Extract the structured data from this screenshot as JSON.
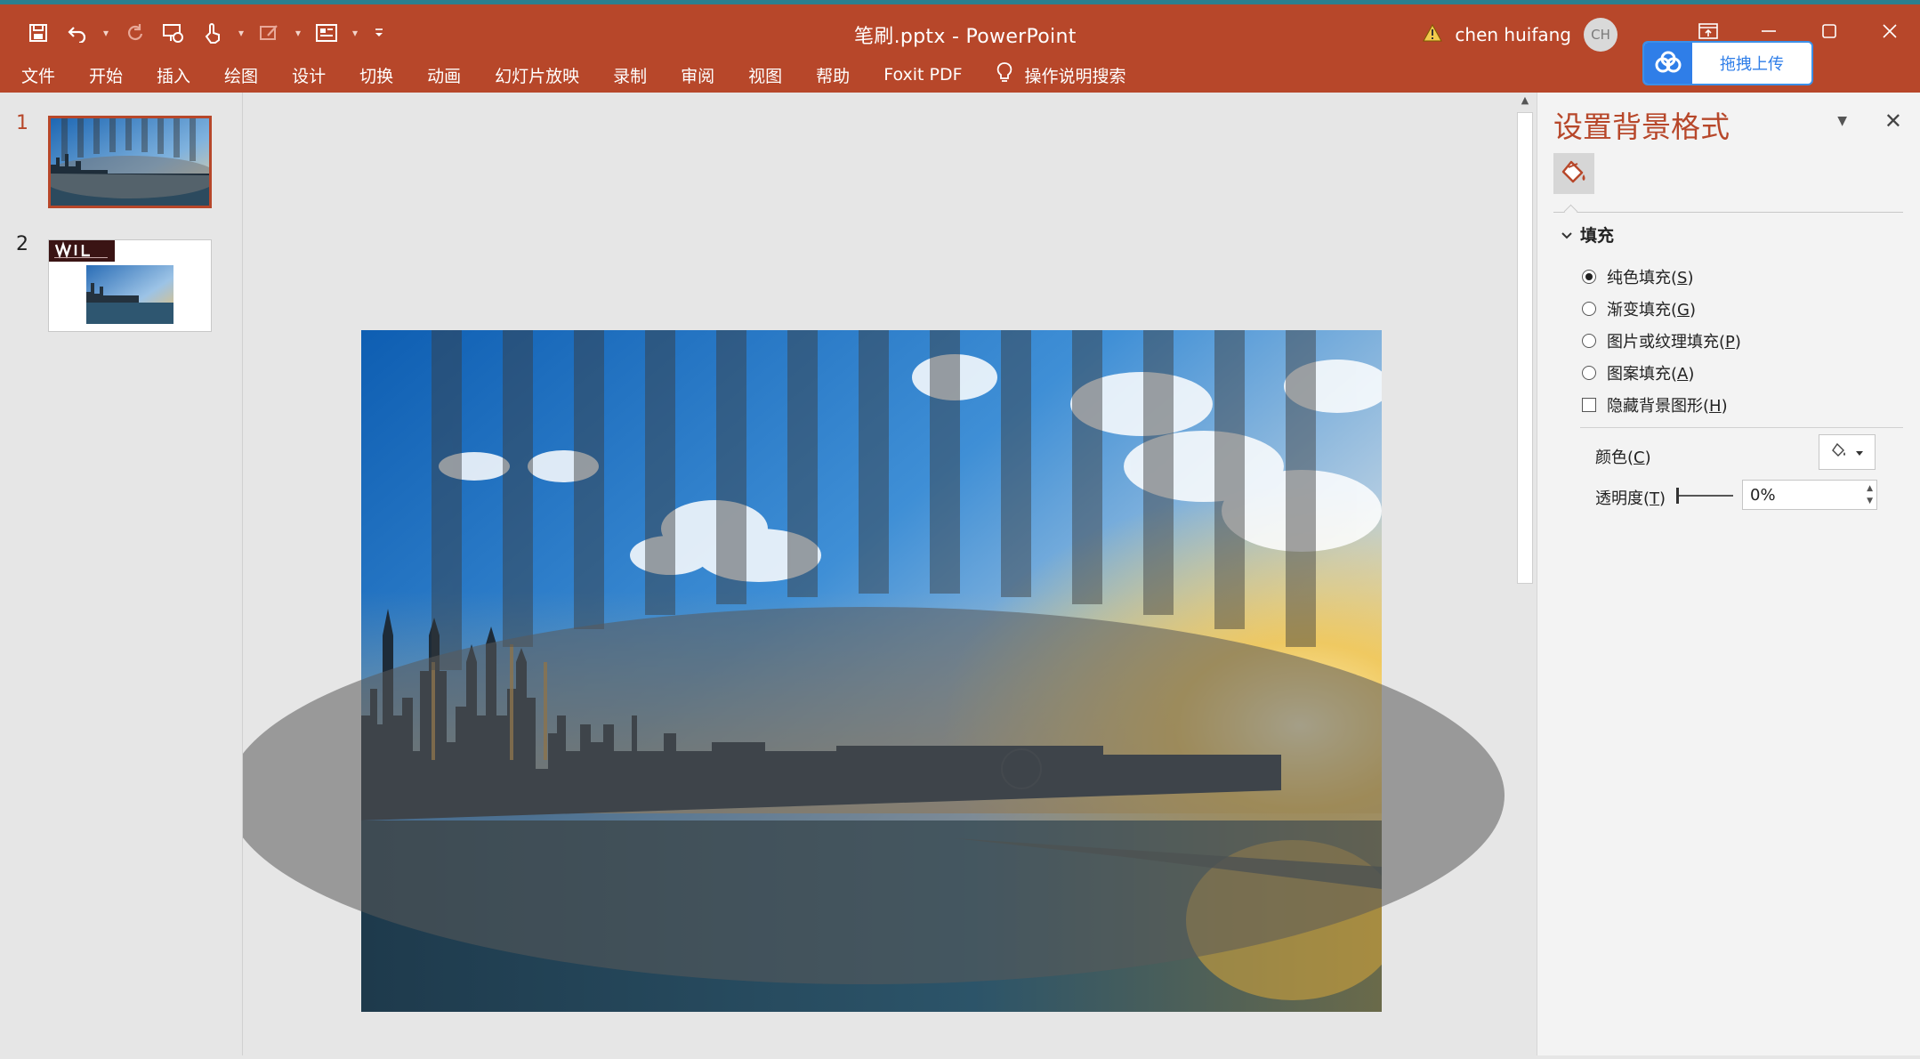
{
  "app": {
    "title": "笔刷.pptx  -  PowerPoint",
    "accent": "#b7472a"
  },
  "user": {
    "name": "chen huifang",
    "initials": "CH"
  },
  "ribbon": {
    "tabs": [
      "文件",
      "开始",
      "插入",
      "绘图",
      "设计",
      "切换",
      "动画",
      "幻灯片放映",
      "录制",
      "审阅",
      "视图",
      "帮助",
      "Foxit PDF"
    ],
    "tell_me": "操作说明搜索"
  },
  "upload_widget": {
    "label": "拖拽上传"
  },
  "slides": [
    {
      "number": "1"
    },
    {
      "number": "2"
    }
  ],
  "format_pane": {
    "title": "设置背景格式",
    "section": "填充",
    "options": [
      {
        "label": "纯色填充",
        "key": "S",
        "type": "radio",
        "selected": true
      },
      {
        "label": "渐变填充",
        "key": "G",
        "type": "radio",
        "selected": false
      },
      {
        "label": "图片或纹理填充",
        "key": "P",
        "type": "radio",
        "selected": false
      },
      {
        "label": "图案填充",
        "key": "A",
        "type": "radio",
        "selected": false
      },
      {
        "label": "隐藏背景图形",
        "key": "H",
        "type": "checkbox",
        "selected": false
      }
    ],
    "color_label": "颜色",
    "color_key": "C",
    "transparency_label": "透明度",
    "transparency_key": "T",
    "transparency_value": "0%"
  }
}
